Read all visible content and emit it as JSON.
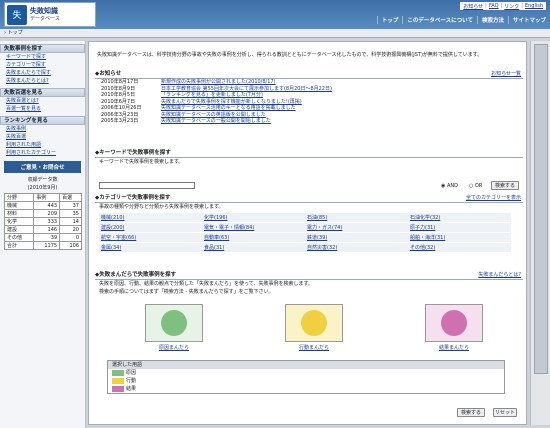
{
  "logo": {
    "mark": "失",
    "title": "失敗知識",
    "subtitle": "データベース"
  },
  "toplinks": [
    "お知らせ",
    "FAQ",
    "リンク",
    "English"
  ],
  "topnav": [
    "トップ",
    "このデータベースについて",
    "検索方法",
    "サイトマップ"
  ],
  "breadcrumb": "トップ",
  "sidebar": {
    "section1": {
      "title": "失敗事例を探す",
      "items": [
        "キーワードで探す",
        "カテゴリーで探す",
        "失敗まんだらで探す",
        "失敗まんだらとは?"
      ]
    },
    "section2": {
      "title": "失敗百選を見る",
      "items": [
        "失敗百選とは?",
        "百選一覧を見る"
      ]
    },
    "section3": {
      "title": "ランキングを見る",
      "items": [
        "失敗事例",
        "失敗百選",
        "利用された用語",
        "利用されたカテゴリー"
      ]
    },
    "opinion": "ご意見・お問合せ",
    "stats_title": "収録データ数",
    "stats_date": "(2010年9月)",
    "stats_headers": [
      "分野",
      "事例",
      "百選"
    ],
    "stats_rows": [
      [
        "機械",
        "443",
        "37"
      ],
      [
        "材料",
        "209",
        "35"
      ],
      [
        "化学",
        "333",
        "14"
      ],
      [
        "建設",
        "146",
        "20"
      ],
      [
        "その他",
        "39",
        "0"
      ],
      [
        "合計",
        "1175",
        "106"
      ]
    ]
  },
  "intro": "失敗知識データベースは、科学技術分野の事故や失敗の事例を分析し、得られる教訓とともにデータベース化したもので、科学技術振興機構(JST)が無料で提供しています。",
  "news": {
    "title": "お知らせ",
    "more": "お知らせ一覧",
    "items": [
      {
        "date": "2010年8月17日",
        "text": "新規作成の失敗事例が公開されました(2010/8/17)"
      },
      {
        "date": "2010年8月9日",
        "text": "日本工学教育協会 第55回年次大会にて展示参加します(8月20日〜8月22日)"
      },
      {
        "date": "2010年8月5日",
        "text": "「ランキングを見る」を更新しました(7月分)"
      },
      {
        "date": "2010年6月7日",
        "text": "失敗まんだらで失敗事例を探す機能が新しくなりました!(再掲)"
      },
      {
        "date": "2006年10月26日",
        "text": "失敗知識データベース活用のキーとなる用語を掲載しました"
      },
      {
        "date": "2006年3月23日",
        "text": "失敗知識データベースの英語版を公開しました"
      },
      {
        "date": "2005年3月23日",
        "text": "失敗知識データベースの一般公開を開始しました"
      }
    ]
  },
  "keyword": {
    "title": "キーワードで失敗事例を探す",
    "desc": "キーワードで失敗事例を検索します。",
    "and": "AND",
    "or": "OR",
    "search": "検索する"
  },
  "category": {
    "title": "カテゴリーで失敗事例を探す",
    "more": "全てのカテゴリーを表示",
    "desc": "事故の種類や分野など分類から失敗事例を検索します。",
    "items": [
      "機械(210)",
      "化学(196)",
      "石油(85)",
      "石油化学(32)",
      "建設(200)",
      "電気・電子・情報(84)",
      "電力・ガス(74)",
      "原子力(31)",
      "航空・宇宙(66)",
      "自動車(63)",
      "鉄道(39)",
      "船舶・海洋(31)",
      "金属(34)",
      "食品(31)",
      "自然災害(32)",
      "その他(32)"
    ]
  },
  "mandala": {
    "title": "失敗まんだらで失敗事例を探す",
    "more": "失敗まんだらとは?",
    "desc1": "失敗を原因、行動、結果の観点で分類した「失敗まんだら」を使って、失敗事例を検索します。",
    "desc2": "検索の手順についてはまず「検索方法 - 失敗まんだらで探す」をご覧下さい。",
    "labels": [
      "原因まんだら",
      "行動まんだら",
      "結果まんだら"
    ],
    "legend_title": "選択した用語",
    "legend_rows": [
      "原因",
      "行動",
      "結果"
    ],
    "search": "検索する",
    "reset": "リセット"
  },
  "colors": {
    "cause": "#7fbf7f",
    "action": "#f0d040",
    "result": "#d070b0",
    "header": "#3f6fa8"
  }
}
